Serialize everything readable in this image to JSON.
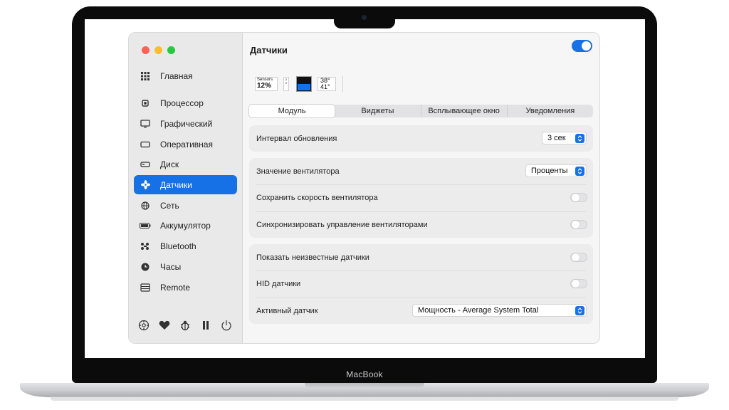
{
  "device": {
    "label": "MacBook"
  },
  "window": {
    "title": "Датчики",
    "module_enabled": true
  },
  "sidebar": {
    "items": [
      {
        "label": "Главная",
        "icon": "grid-icon",
        "active": false
      },
      {
        "label": "Процессор",
        "icon": "cpu-icon",
        "active": false
      },
      {
        "label": "Графический",
        "icon": "display-icon",
        "active": false
      },
      {
        "label": "Оперативная",
        "icon": "memory-icon",
        "active": false
      },
      {
        "label": "Диск",
        "icon": "disk-icon",
        "active": false
      },
      {
        "label": "Датчики",
        "icon": "fan-icon",
        "active": true
      },
      {
        "label": "Сеть",
        "icon": "globe-icon",
        "active": false
      },
      {
        "label": "Аккумулятор",
        "icon": "battery-icon",
        "active": false
      },
      {
        "label": "Bluetooth",
        "icon": "bluetooth-icon",
        "active": false
      },
      {
        "label": "Часы",
        "icon": "clock-icon",
        "active": false
      },
      {
        "label": "Remote",
        "icon": "remote-icon",
        "active": false
      }
    ],
    "footer_icons": [
      "settings-icon",
      "heart-icon",
      "bug-icon",
      "pause-icon",
      "power-icon"
    ]
  },
  "widgets": {
    "mini": {
      "caption": "Sensors",
      "value": "12%"
    },
    "stack": {
      "top": "2",
      "bottom": "2"
    },
    "temps": {
      "line1": "38°",
      "line2": "41°"
    }
  },
  "tabs": [
    "Модуль",
    "Виджеты",
    "Всплывающее окно",
    "Уведомления"
  ],
  "selected_tab": "Модуль",
  "settings": {
    "update_interval": {
      "label": "Интервал обновления",
      "value": "3 сек"
    },
    "fan_value": {
      "label": "Значение вентилятора",
      "value": "Проценты"
    },
    "save_fan_speed": {
      "label": "Сохранить скорость вентилятора",
      "enabled": false
    },
    "sync_fan_control": {
      "label": "Синхронизировать управление вентиляторами",
      "enabled": false
    },
    "show_unknown": {
      "label": "Показать неизвестные датчики",
      "enabled": false
    },
    "hid_sensors": {
      "label": "HID датчики",
      "enabled": false
    },
    "active_sensor": {
      "label": "Активный датчик",
      "value": "Мощность - Average System Total"
    }
  },
  "colors": {
    "accent": "#1670e6",
    "close": "#fe5f57",
    "minimize": "#febc2e",
    "zoom": "#28c840"
  }
}
